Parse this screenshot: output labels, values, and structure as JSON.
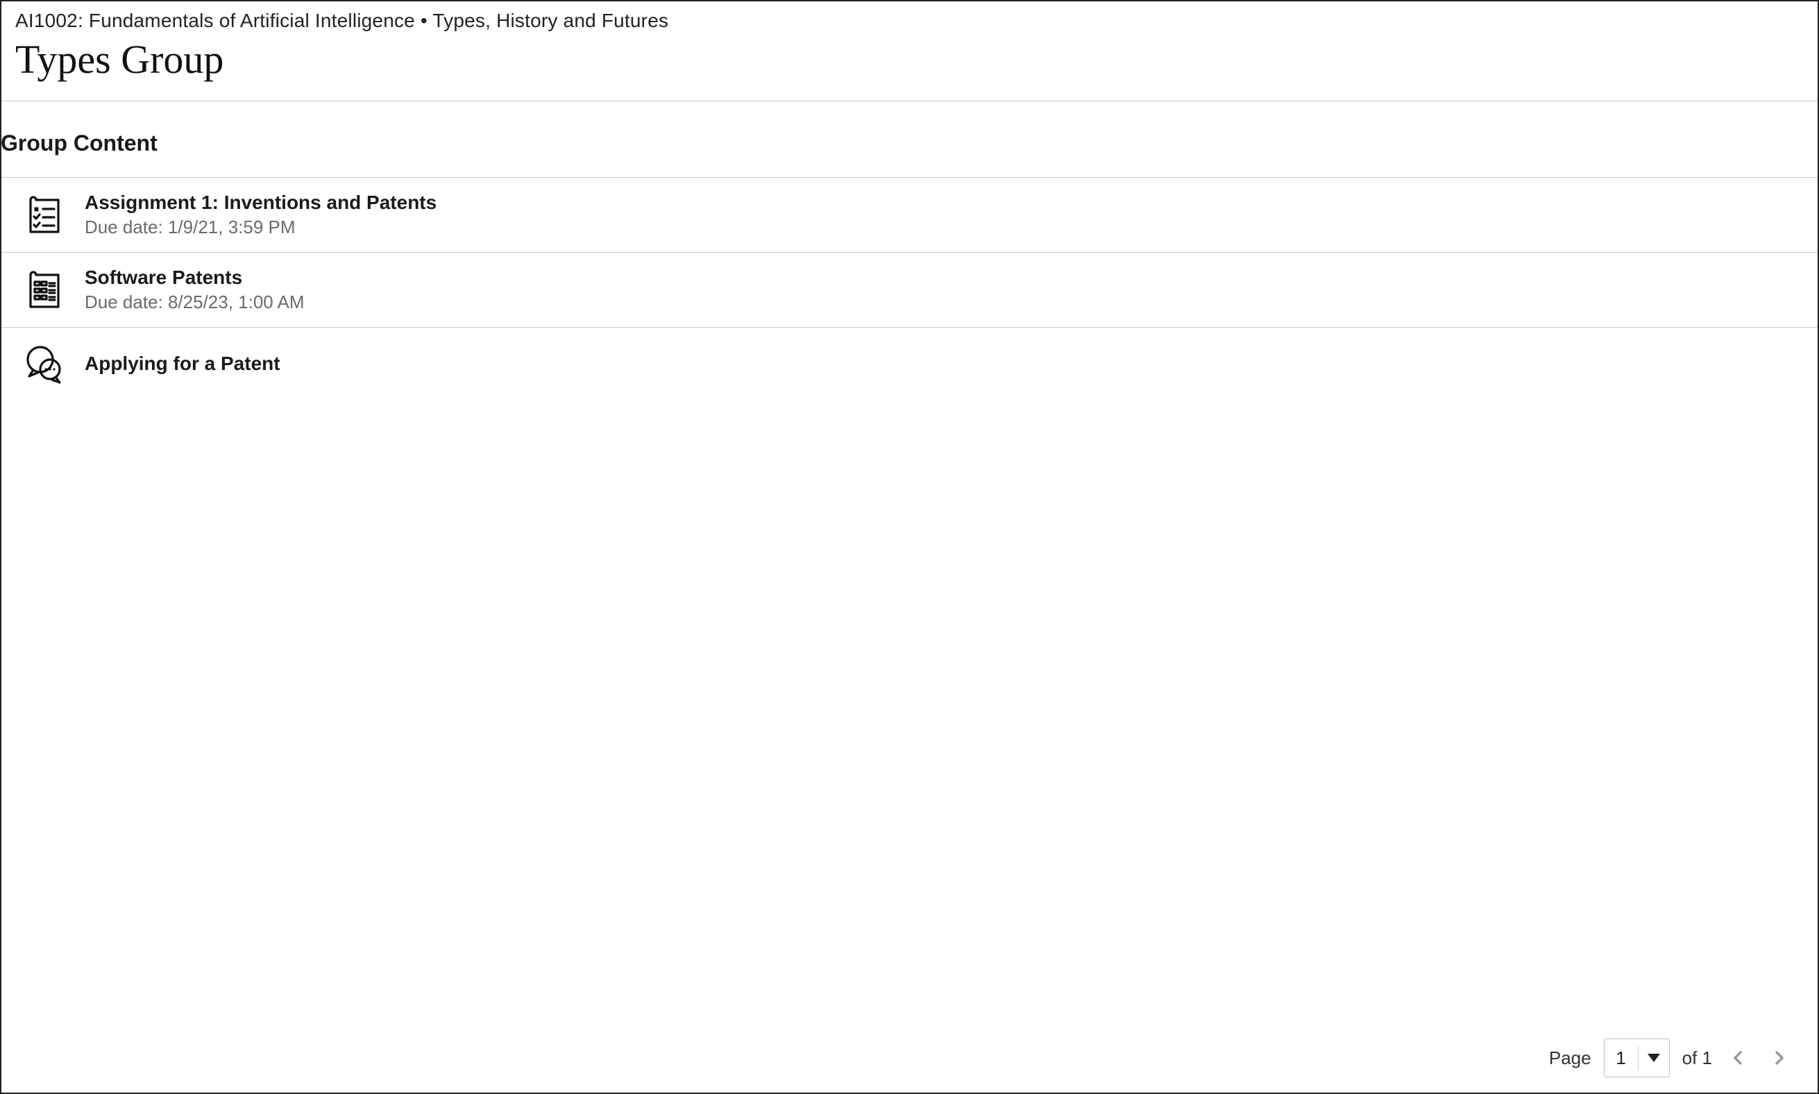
{
  "breadcrumb": "AI1002: Fundamentals of Artificial Intelligence • Types, History and Futures",
  "page_title": "Types Group",
  "section_title": "Group Content",
  "items": [
    {
      "icon": "assignment",
      "title": "Assignment 1: Inventions and Patents",
      "subtitle": "Due date: 1/9/21, 3:59 PM"
    },
    {
      "icon": "test",
      "title": "Software Patents",
      "subtitle": "Due date: 8/25/23, 1:00 AM"
    },
    {
      "icon": "discussion",
      "title": "Applying for a Patent",
      "subtitle": ""
    }
  ],
  "pager": {
    "label": "Page",
    "current": "1",
    "of_label": "of",
    "total": "1"
  }
}
